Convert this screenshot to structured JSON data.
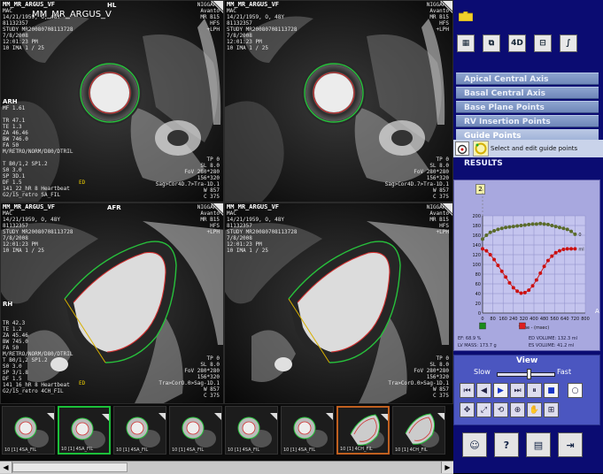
{
  "series": {
    "title": "MM_MR_ARGUS_V",
    "color_panel": "#0b0c72"
  },
  "viewports": [
    {
      "title": "MM_MR_ARGUS_VF",
      "patient": "MAC",
      "dob_line": "14/21/1959, O, 48Y",
      "id": "81132357",
      "study": "STUDY MR20080708113728",
      "date": "7/8/2008",
      "time": "12:01:23 PM",
      "ima": "10 IMA 1 / 25",
      "orient_top": "HL",
      "orient_left": "ARH",
      "right_top": [
        "NIGGARD",
        "Avanto",
        "MR B15",
        "HFS",
        "+LPH",
        "",
        "",
        "",
        "",
        ""
      ],
      "left_mid": [
        "MF 1.61",
        "",
        "TR 47.1",
        "TE 1.3",
        "ZA 46.46",
        "BW 746.0",
        "FA 50",
        "M/RETRO/NORM/D80/DTRIL",
        "",
        "T B0/1,2 SP1.2",
        "S0 3.0",
        "SP 3D.1",
        "DF 1.5",
        "141_22_hR 8 Heartbeat",
        "G2/15_retro SA_FIL"
      ],
      "right_mid": [
        "TP 0",
        "SL 8.0",
        "FoV 280*280",
        "156*320",
        "Sag>Cor4D.7>Tra-1D.1",
        "W 857",
        "C 375"
      ],
      "ed_label": "ED"
    },
    {
      "title": "MM_MR_ARGUS_VF",
      "patient": "MAC",
      "dob_line": "14/21/1959, O, 48Y",
      "id": "81132357",
      "study": "STUDY MR20080708113728",
      "date": "7/8/2008",
      "time": "12:01:23 PM",
      "ima": "10 IMA 1 / 25",
      "orient_top": "",
      "orient_left": "",
      "right_top": [
        "NIGGARD",
        "Avanto",
        "MR B15",
        "HFS",
        "+LPH"
      ],
      "left_mid": [],
      "right_mid": [
        "TP 0",
        "SL 8.0",
        "FoV 280*280",
        "156*320",
        "Sag>Cor4D.7>Tra-1D.1",
        "W 857",
        "C 375"
      ],
      "ed_label": ""
    },
    {
      "title": "MM_MR_ARGUS_VF",
      "patient": "MAC",
      "dob_line": "14/21/1959, O, 48Y",
      "id": "81132357",
      "study": "STUDY MR20080708113728",
      "date": "7/8/2008",
      "time": "12:01:23 PM",
      "ima": "10 IMA 1 / 25",
      "orient_top": "AFR",
      "orient_left": "RH",
      "right_top": [
        "NIGGARD",
        "Avanto",
        "MR B15",
        "HFS",
        "+LPH"
      ],
      "left_mid": [
        "TR 42.3",
        "TE 1.2",
        "ZA 45.46",
        "BW 745.0",
        "FA 50",
        "M/RETRO/NORM/D80/DTRIL",
        "T B0/1,2 SP1.2",
        "S0 3.0",
        "SP 3/1.8",
        "DF 1.5",
        "141_16_hR 8 Heartbeat",
        "G2/15_retro 4CH_FIL"
      ],
      "right_mid": [
        "TP 0",
        "SL 8.0",
        "FoV 280*280",
        "156*320",
        "Tra>CorO.0>Sag-1D.1",
        "W 857",
        "C 375"
      ],
      "ed_label": "ED"
    },
    {
      "title": "MM_MR_ARGUS_VF",
      "patient": "MAC",
      "dob_line": "14/21/1959, O, 48Y",
      "id": "81132357",
      "study": "STUDY MR20080708113728",
      "date": "7/8/2008",
      "time": "12:01:23 PM",
      "ima": "10 IMA 1 / 25",
      "orient_top": "",
      "orient_left": "",
      "right_top": [
        "NIGGARD",
        "Avanto",
        "MR B15",
        "HFS",
        "+LPH"
      ],
      "left_mid": [],
      "right_mid": [
        "TP 0",
        "SL 8.0",
        "FoV 280*280",
        "156*320",
        "Tra>CorO.0>Sag-1D.1",
        "W 857",
        "C 375"
      ],
      "ed_label": ""
    }
  ],
  "thumbnails": [
    {
      "label": "10 [1] 4SA_FIL",
      "view": "sa",
      "border": "none"
    },
    {
      "label": "10 [1] 4SA_FIL",
      "view": "sa",
      "border": "green"
    },
    {
      "label": "10 [1] 4SA_FIL",
      "view": "sa",
      "border": "none"
    },
    {
      "label": "10 [1] 4SA_FIL",
      "view": "sa",
      "border": "none"
    },
    {
      "label": "10 [1] 4SA_FIL",
      "view": "sa",
      "border": "none"
    },
    {
      "label": "10 [1] 4SA_FIL",
      "view": "sa",
      "border": "none"
    },
    {
      "label": "10 [1] 4CH_FIL",
      "view": "lax",
      "border": "orange"
    },
    {
      "label": "10 [1] 4CH_FIL",
      "view": "lax",
      "border": "none"
    }
  ],
  "toolbar_icons": [
    {
      "name": "layout-grid-icon",
      "glyph": "▦"
    },
    {
      "name": "copy-icon",
      "glyph": "⧉"
    },
    {
      "name": "4d-icon",
      "glyph": "4D"
    },
    {
      "name": "slider-icon",
      "glyph": "⊟"
    },
    {
      "name": "curve-icon",
      "glyph": "∫"
    }
  ],
  "menu": [
    {
      "label": "Apical Central Axis",
      "active": false
    },
    {
      "label": "Basal Central Axis",
      "active": false
    },
    {
      "label": "Base Plane Points",
      "active": false
    },
    {
      "label": "RV Insertion Points",
      "active": false
    },
    {
      "label": "Guide Points",
      "active": true
    }
  ],
  "guide_hint": "Select and edit guide points",
  "results_label": "RESULTS",
  "chart_marker": "2",
  "stats": {
    "ef": "EF: 68.9 %",
    "ed_volume": "ED VOLUME: 132.3 ml",
    "lv_mass": "LV MASS: 173.7 g",
    "es_volume": "ES VOLUME: 41.2 ml"
  },
  "chart_data": {
    "type": "line",
    "xlabel": "Time - (msec)",
    "ylabel": "",
    "xlim": [
      0,
      800
    ],
    "ylim": [
      0,
      200
    ],
    "x_ticks": [
      0,
      80,
      160,
      240,
      320,
      400,
      480,
      560,
      640,
      720,
      800
    ],
    "y_ticks": [
      0,
      20,
      40,
      60,
      80,
      100,
      120,
      140,
      160,
      180,
      200
    ],
    "series": [
      {
        "color": "#5a6b2a",
        "end_label": "0",
        "x": [
          0,
          30,
          60,
          90,
          120,
          150,
          180,
          210,
          240,
          270,
          300,
          330,
          360,
          390,
          420,
          450,
          480,
          510,
          540,
          570,
          600,
          630,
          660,
          690,
          720
        ],
        "values": [
          152,
          160,
          166,
          169,
          172,
          174,
          176,
          177,
          178,
          179,
          180,
          181,
          182,
          183,
          183,
          184,
          183,
          182,
          180,
          178,
          176,
          174,
          172,
          168,
          162
        ]
      },
      {
        "color": "#cc1111",
        "end_label": "ml",
        "x": [
          0,
          30,
          60,
          90,
          120,
          150,
          180,
          210,
          240,
          270,
          300,
          330,
          360,
          390,
          420,
          450,
          480,
          510,
          540,
          570,
          600,
          630,
          660,
          690,
          720
        ],
        "values": [
          132,
          128,
          120,
          110,
          98,
          86,
          74,
          62,
          52,
          45,
          41,
          42,
          47,
          56,
          68,
          82,
          96,
          108,
          117,
          124,
          128,
          131,
          132,
          132,
          132
        ]
      }
    ],
    "markers": [
      {
        "x": 0,
        "color": "#1a8c1a"
      },
      {
        "x": 310,
        "color": "#dd2020"
      }
    ],
    "grid": true,
    "legend": "none"
  },
  "view": {
    "title": "View",
    "slow": "Slow",
    "fast": "Fast",
    "speed": 0.55
  },
  "view_buttons_row1": [
    {
      "name": "first-frame-icon",
      "glyph": "⏮"
    },
    {
      "name": "prev-frame-icon",
      "glyph": "◀"
    },
    {
      "name": "play-icon",
      "glyph": "▶"
    },
    {
      "name": "next-frame-icon",
      "glyph": "⏭"
    },
    {
      "name": "pause-icon",
      "glyph": "⏸"
    },
    {
      "name": "stop-icon",
      "glyph": "■"
    },
    {
      "name": "circle-icon",
      "glyph": "○"
    }
  ],
  "view_buttons_row2": [
    {
      "name": "move-icon",
      "glyph": "✥"
    },
    {
      "name": "resize-icon",
      "glyph": "⤢"
    },
    {
      "name": "rotate-icon",
      "glyph": "⟲"
    },
    {
      "name": "zoom-icon",
      "glyph": "⊕"
    },
    {
      "name": "pan-icon",
      "glyph": "✋"
    },
    {
      "name": "reset-icon",
      "glyph": "⊞"
    }
  ],
  "bottom_buttons": [
    {
      "name": "user-help-icon",
      "glyph": "☺"
    },
    {
      "name": "help-icon",
      "glyph": "?"
    },
    {
      "name": "document-icon",
      "glyph": "▤"
    },
    {
      "name": "exit-icon",
      "glyph": "⇥"
    }
  ]
}
